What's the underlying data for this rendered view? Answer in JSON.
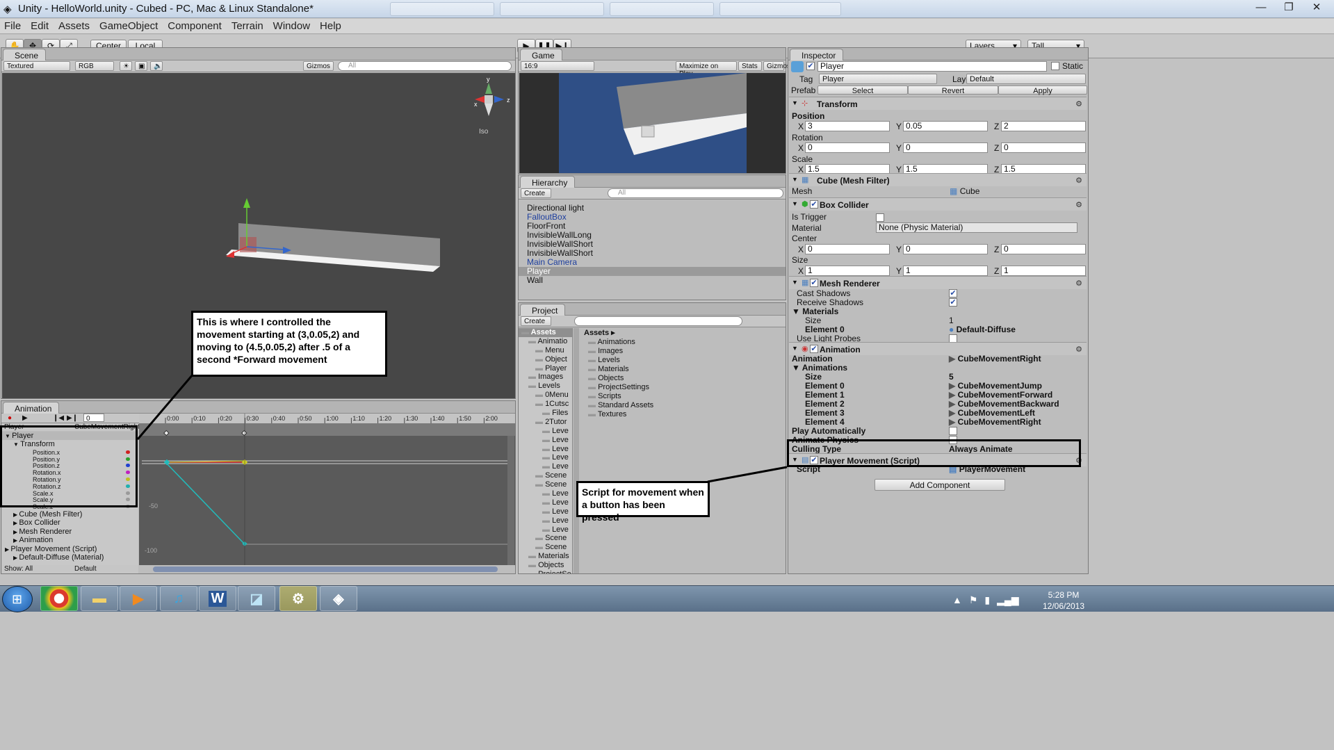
{
  "window": {
    "title": "Unity - HelloWorld.unity - Cubed - PC, Mac & Linux Standalone*",
    "minimize": "—",
    "maximize": "❐",
    "close": "✕"
  },
  "menubar": [
    "File",
    "Edit",
    "Assets",
    "GameObject",
    "Component",
    "Terrain",
    "Window",
    "Help"
  ],
  "toolbar": {
    "pivot": "Center",
    "space": "Local",
    "layers": "Layers",
    "layout": "Tall"
  },
  "scene": {
    "tab": "Scene",
    "render_mode": "Textured",
    "color_mode": "RGB",
    "gizmos": "Gizmos",
    "search": "All",
    "axis_y": "y",
    "axis_x": "x",
    "axis_z": "z",
    "projection": "Iso"
  },
  "game": {
    "tab": "Game",
    "aspect": "16:9",
    "maximize": "Maximize on Play",
    "stats": "Stats",
    "gizmos": "Gizmos"
  },
  "hierarchy": {
    "tab": "Hierarchy",
    "create": "Create",
    "search": "All",
    "items": [
      {
        "label": "Directional light",
        "color": "#111111"
      },
      {
        "label": "FalloutBox",
        "color": "#1e3f9e"
      },
      {
        "label": "FloorFront",
        "color": "#111111"
      },
      {
        "label": "InvisibleWallLong",
        "color": "#111111"
      },
      {
        "label": "InvisibleWallShort",
        "color": "#111111"
      },
      {
        "label": "InvisibleWallShort",
        "color": "#111111"
      },
      {
        "label": "Main Camera",
        "color": "#1e3f9e"
      },
      {
        "label": "Player",
        "color": "#ffffff"
      },
      {
        "label": "Wall",
        "color": "#111111"
      }
    ]
  },
  "project": {
    "tab": "Project",
    "create": "Create",
    "tree": [
      {
        "label": "Assets",
        "indent": 0
      },
      {
        "label": "Animatio",
        "indent": 1
      },
      {
        "label": "Menu",
        "indent": 2
      },
      {
        "label": "Object",
        "indent": 2
      },
      {
        "label": "Player",
        "indent": 2
      },
      {
        "label": "Images",
        "indent": 1
      },
      {
        "label": "Levels",
        "indent": 1
      },
      {
        "label": "0Menu",
        "indent": 2
      },
      {
        "label": "1Cutsc",
        "indent": 2
      },
      {
        "label": "Files",
        "indent": 3
      },
      {
        "label": "2Tutor",
        "indent": 2
      },
      {
        "label": "Leve",
        "indent": 3
      },
      {
        "label": "Leve",
        "indent": 3
      },
      {
        "label": "Leve",
        "indent": 3
      },
      {
        "label": "Leve",
        "indent": 3
      },
      {
        "label": "Leve",
        "indent": 3
      },
      {
        "label": "Scene",
        "indent": 2
      },
      {
        "label": "Scene",
        "indent": 2
      },
      {
        "label": "Leve",
        "indent": 3
      },
      {
        "label": "Leve",
        "indent": 3
      },
      {
        "label": "Leve",
        "indent": 3
      },
      {
        "label": "Leve",
        "indent": 3
      },
      {
        "label": "Leve",
        "indent": 3
      },
      {
        "label": "Scene",
        "indent": 2
      },
      {
        "label": "Scene",
        "indent": 2
      },
      {
        "label": "Materials",
        "indent": 1
      },
      {
        "label": "Objects",
        "indent": 1
      },
      {
        "label": "ProjectSe",
        "indent": 1
      }
    ],
    "breadcrumb": "Assets",
    "folders": [
      "Animations",
      "Images",
      "Levels",
      "Materials",
      "Objects",
      "ProjectSettings",
      "Scripts",
      "Standard Assets",
      "Textures"
    ]
  },
  "inspector": {
    "tab": "Inspector",
    "object_name": "Player",
    "static": "Static",
    "tag_label": "Tag",
    "tag": "Player",
    "layer_label": "Layer",
    "layer": "Default",
    "prefab_label": "Prefab",
    "prefab_select": "Select",
    "prefab_revert": "Revert",
    "prefab_apply": "Apply",
    "transform": {
      "title": "Transform",
      "position": "Position",
      "rotation": "Rotation",
      "scale": "Scale",
      "pos": [
        "3",
        "0.05",
        "2"
      ],
      "rot": [
        "0",
        "0",
        "0"
      ],
      "scl": [
        "1.5",
        "1.5",
        "1.5"
      ]
    },
    "axes": [
      "X",
      "Y",
      "Z"
    ],
    "mesh_filter": {
      "title": "Cube (Mesh Filter)",
      "mesh_label": "Mesh",
      "mesh": "Cube"
    },
    "box_collider": {
      "title": "Box Collider",
      "is_trigger": "Is Trigger",
      "material_label": "Material",
      "material": "None (Physic Material)",
      "center": "Center",
      "size": "Size",
      "center_vals": [
        "0",
        "0",
        "0"
      ],
      "size_vals": [
        "1",
        "1",
        "1"
      ]
    },
    "mesh_renderer": {
      "title": "Mesh Renderer",
      "cast_shadows": "Cast Shadows",
      "receive_shadows": "Receive Shadows",
      "materials": "Materials",
      "size_label": "Size",
      "size": "1",
      "element0_label": "Element 0",
      "element0": "Default-Diffuse",
      "light_probes": "Use Light Probes"
    },
    "animation": {
      "title": "Animation",
      "animation_label": "Animation",
      "animation": "CubeMovementRight",
      "animations": "Animations",
      "size_label": "Size",
      "size": "5",
      "elements": [
        {
          "label": "Element 0",
          "value": "CubeMovementJump"
        },
        {
          "label": "Element 1",
          "value": "CubeMovementForward"
        },
        {
          "label": "Element 2",
          "value": "CubeMovementBackward"
        },
        {
          "label": "Element 3",
          "value": "CubeMovementLeft"
        },
        {
          "label": "Element 4",
          "value": "CubeMovementRight"
        }
      ],
      "play_auto": "Play Automatically",
      "animate_physics": "Animate Physics",
      "culling_label": "Culling Type",
      "culling": "Always Animate"
    },
    "player_movement": {
      "title": "Player Movement (Script)",
      "script_label": "Script",
      "script": "PlayerMovement"
    },
    "add_component": "Add Component"
  },
  "animation_panel": {
    "tab": "Animation",
    "frame": "0",
    "object": "Player",
    "clip": "CubeMovementRight",
    "ticks": [
      "0:00",
      "0:10",
      "0:20",
      "0:30",
      "0:40",
      "0:50",
      "1:00",
      "1:10",
      "1:20",
      "1:30",
      "1:40",
      "1:50",
      "2:00"
    ],
    "y_labels": [
      "-50",
      "-100"
    ],
    "properties": [
      {
        "label": "Player",
        "indent": 0,
        "dot": ""
      },
      {
        "label": "Transform",
        "indent": 1,
        "dot": ""
      },
      {
        "label": "Position.x",
        "indent": 2,
        "dot": "#d02020"
      },
      {
        "label": "Position.y",
        "indent": 2,
        "dot": "#2aa02a"
      },
      {
        "label": "Position.z",
        "indent": 2,
        "dot": "#2040d0"
      },
      {
        "label": "Rotation.x",
        "indent": 2,
        "dot": "#c020c0"
      },
      {
        "label": "Rotation.y",
        "indent": 2,
        "dot": "#c0c020"
      },
      {
        "label": "Rotation.z",
        "indent": 2,
        "dot": "#20b0b0"
      },
      {
        "label": "Scale.x",
        "indent": 2,
        "dot": "#9a9a9a"
      },
      {
        "label": "Scale.y",
        "indent": 2,
        "dot": "#9a9a9a"
      },
      {
        "label": "Scale.z",
        "indent": 2,
        "dot": "#9a9a9a"
      },
      {
        "label": "Cube (Mesh Filter)",
        "indent": 1,
        "dot": ""
      },
      {
        "label": "Box Collider",
        "indent": 1,
        "dot": ""
      },
      {
        "label": "Mesh Renderer",
        "indent": 1,
        "dot": ""
      },
      {
        "label": "Animation",
        "indent": 1,
        "dot": ""
      },
      {
        "label": "Player Movement (Script)",
        "indent": 0,
        "dot": ""
      },
      {
        "label": "Default-Diffuse (Material)",
        "indent": 1,
        "dot": ""
      }
    ],
    "show_label": "Show: All",
    "wrap_mode": "Default"
  },
  "annotations": {
    "movement": "This is where I controlled the movement starting at (3,0.05,2) and moving to (4.5,0.05,2) after .5 of a second *Forward movement",
    "script": "Script for movement when a button has been pressed"
  },
  "taskbar": {
    "time": "5:28 PM",
    "date": "12/06/2013"
  }
}
